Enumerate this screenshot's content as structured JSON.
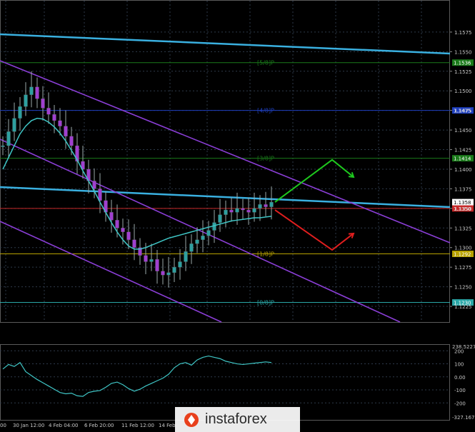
{
  "chart_data": {
    "type": "candlestick",
    "price_ticks": [
      "1.1575",
      "1.1550",
      "1.1525",
      "1.1500",
      "1.1475",
      "1.1450",
      "1.1425",
      "1.1400",
      "1.1375",
      "1.1350",
      "1.1325",
      "1.1300",
      "1.1275",
      "1.1250",
      "1.1225"
    ],
    "price_range": [
      1.1205,
      1.1615
    ],
    "time_labels": [
      "00",
      "30 Jan 12:00",
      "4 Feb 04:00",
      "6 Feb 20:00",
      "11 Feb 12:00",
      "14 Feb"
    ],
    "murray_levels": [
      {
        "label": "[5/8]P",
        "price": 1.1536,
        "color": "#1a7a1a",
        "tag": "1.1536"
      },
      {
        "label": "[4/8]P",
        "price": 1.1475,
        "color": "#1e3fbf",
        "tag": "1.1475"
      },
      {
        "label": "[3/8]P",
        "price": 1.1414,
        "color": "#1a7a1a",
        "tag": "1.1414"
      },
      {
        "label": "[1/8]P",
        "price": 1.1292,
        "color": "#b8a200",
        "tag": "1.1292"
      },
      {
        "label": "[0/8]P",
        "price": 1.123,
        "color": "#2aa7a7",
        "tag": "1.1230"
      }
    ],
    "current_price": {
      "price": 1.1358,
      "tag": "1.1358"
    },
    "red_level": {
      "price": 1.135,
      "tag": "1.1350"
    },
    "series": [
      {
        "name": "price",
        "values": [
          1.143,
          1.1448,
          1.1465,
          1.148,
          1.1495,
          1.1505,
          1.149,
          1.1478,
          1.147,
          1.1462,
          1.1455,
          1.1442,
          1.143,
          1.141,
          1.14,
          1.1385,
          1.1375,
          1.136,
          1.1345,
          1.1335,
          1.1325,
          1.132,
          1.131,
          1.13,
          1.129,
          1.1282,
          1.1285,
          1.127,
          1.1265,
          1.1268,
          1.1275,
          1.1282,
          1.1295,
          1.1305,
          1.131,
          1.1315,
          1.1322,
          1.1332,
          1.1342,
          1.1348,
          1.1345,
          1.135,
          1.1348,
          1.1345,
          1.135,
          1.1355,
          1.1352,
          1.1358
        ]
      },
      {
        "name": "ma",
        "values": [
          1.14,
          1.1415,
          1.143,
          1.1445,
          1.1455,
          1.1462,
          1.1465,
          1.1464,
          1.146,
          1.1454,
          1.1446,
          1.1436,
          1.1424,
          1.1412,
          1.1398,
          1.1385,
          1.1372,
          1.1358,
          1.1345,
          1.1332,
          1.132,
          1.131,
          1.1302,
          1.1298,
          1.1298,
          1.13,
          1.1303,
          1.1306,
          1.1309,
          1.1312,
          1.1314,
          1.1316,
          1.1318,
          1.132,
          1.1322,
          1.1324,
          1.1326,
          1.1328,
          1.133,
          1.1332,
          1.1334,
          1.1335,
          1.1336,
          1.1337,
          1.1338,
          1.1338,
          1.1339,
          1.134
        ]
      }
    ],
    "forecast": {
      "up": [
        [
          1.1358
        ],
        [
          1.1412
        ],
        [
          1.139
        ]
      ],
      "down": [
        [
          1.1348
        ],
        [
          1.1297
        ],
        [
          1.1318
        ]
      ]
    },
    "oscillator": {
      "ticks": [
        "200",
        "100",
        "0.00",
        "-100",
        "-200"
      ],
      "top_label": "238.5227",
      "bottom_label": "-327.1677",
      "range": [
        -330,
        240
      ],
      "values": [
        60,
        95,
        80,
        110,
        40,
        10,
        -20,
        -45,
        -70,
        -95,
        -120,
        -130,
        -125,
        -145,
        -150,
        -120,
        -110,
        -105,
        -80,
        -50,
        -40,
        -60,
        -90,
        -110,
        -95,
        -70,
        -50,
        -30,
        -10,
        20,
        70,
        100,
        110,
        90,
        130,
        150,
        160,
        150,
        140,
        120,
        110,
        100,
        95,
        100,
        105,
        110,
        115,
        110
      ]
    }
  },
  "watermark": {
    "brand": "instaforex"
  }
}
